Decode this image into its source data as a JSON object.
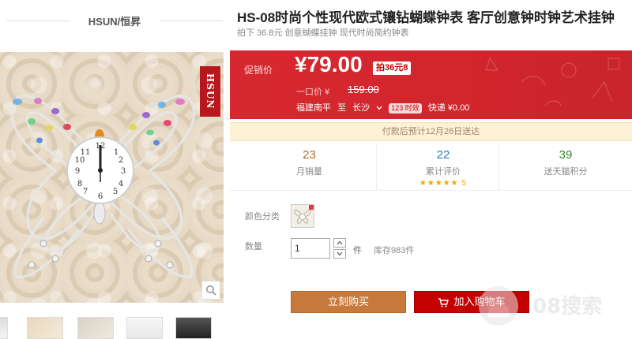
{
  "brand": {
    "name": "HSUN/恒昇"
  },
  "image": {
    "tag_text": "HSUN"
  },
  "product": {
    "title": "HS-08时尚个性现代欧式镶钻蝴蝶钟表 客厅创意钟时钟艺术挂钟",
    "subtitle_prefix": "拍下 36.8元 创意蝴蝶挂钟 现代时尚简约钟表"
  },
  "price": {
    "promo_label": "促销价",
    "current": "¥79.00",
    "discount_badge": "拍36元8",
    "original_label": "一口价 ¥",
    "original": "159.00",
    "ship_from": "福建南平",
    "ship_to_label": "至",
    "ship_to": "长沙",
    "days_badge": "123 时效",
    "delivery_fee": "快递 ¥0.00"
  },
  "delivery_notice": "付款后预计12月26日送达",
  "stats": [
    {
      "num": "23",
      "label": "月销量",
      "color": "#b46b33"
    },
    {
      "num": "22",
      "label": "累计评价",
      "color": "#2a7bb5",
      "stars": "★★★★★",
      "score": "5"
    },
    {
      "num": "39",
      "label": "送天猫积分",
      "color": "#2f8a24"
    }
  ],
  "options": {
    "color_label": "颜色分类",
    "qty_label": "数量",
    "qty_value": "1",
    "unit": "件",
    "stock": "库存983件"
  },
  "buttons": {
    "buy_now": "立刻购买",
    "add_cart": "加入购物车"
  },
  "watermark": "08搜索",
  "colors": {
    "accent": "#d7282f",
    "buy_now": "#c77a3b",
    "add_cart": "#c40000"
  }
}
